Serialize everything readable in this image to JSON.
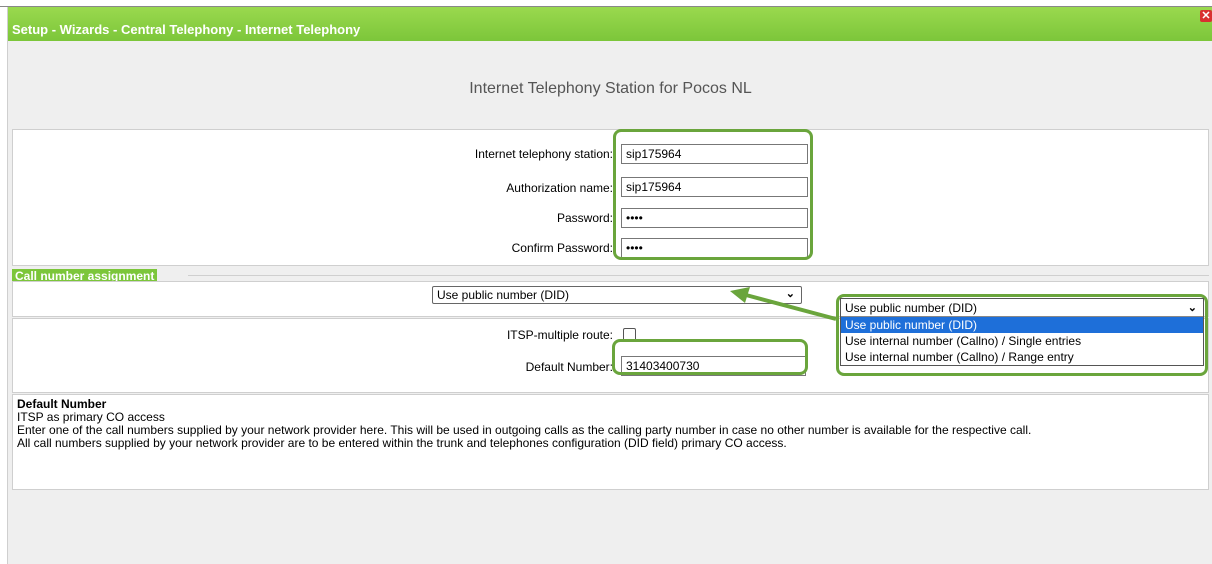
{
  "window": {
    "title": "Setup - Wizards - Central Telephony - Internet Telephony",
    "close_glyph": "✕"
  },
  "heading": "Internet Telephony Station for Pocos NL",
  "station": {
    "station_label": "Internet telephony station:",
    "station_value": "sip175964",
    "auth_label": "Authorization name:",
    "auth_value": "sip175964",
    "password_label": "Password:",
    "password_value": "••••",
    "confirm_label": "Confirm Password:",
    "confirm_value": "••••"
  },
  "call_number": {
    "section_title": "Call number assignment",
    "selected": "Use public number (DID)",
    "options": [
      "Use public number (DID)",
      "Use internal number (Callno) / Single entries",
      "Use internal number (Callno) / Range entry"
    ]
  },
  "routing": {
    "multi_route_label": "ITSP-multiple route:",
    "multi_route_checked": false,
    "default_number_label": "Default Number:",
    "default_number_value": "31403400730"
  },
  "help": {
    "title": "Default Number",
    "line1": "ITSP as primary CO access",
    "line2": "Enter one of the call numbers supplied by your network provider here. This will be used in outgoing calls as the calling party number in case no other number is available for the respective call.",
    "line3": "All call numbers supplied by your network provider are to be entered within the trunk and telephones configuration (DID field) primary CO access."
  },
  "colors": {
    "accent": "#7cc63a",
    "highlight": "#6aa53c",
    "selection": "#1e6fd9"
  },
  "icons": {
    "dropdown": "chevron-down-icon",
    "close": "close-icon"
  }
}
